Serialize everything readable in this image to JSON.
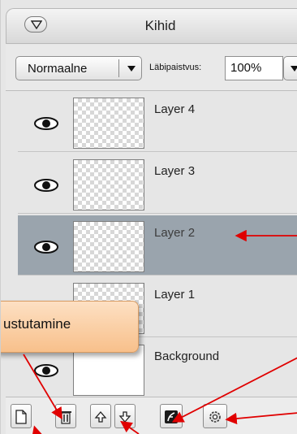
{
  "panel": {
    "title": "Kihid",
    "blend_mode": "Normaalne",
    "opacity_label": "Läbipaistvus:",
    "opacity_value": "100%"
  },
  "layers": [
    {
      "name": "Layer 4",
      "visible": true,
      "selected": false
    },
    {
      "name": "Layer 3",
      "visible": true,
      "selected": false
    },
    {
      "name": "Layer 2",
      "visible": true,
      "selected": true
    },
    {
      "name": "Layer 1",
      "visible": true,
      "selected": false
    },
    {
      "name": "Background",
      "visible": true,
      "selected": false
    }
  ],
  "tooltip": {
    "text": "ustutamine"
  },
  "toolbar_icons": [
    "new-layer-icon",
    "trash-icon",
    "move-up-icon",
    "move-down-icon",
    "layer-style-icon",
    "gear-icon"
  ],
  "colors": {
    "selected_row": "#9aa4ad",
    "annotation_arrow": "#e00000",
    "tooltip_fill": "#f8c08b"
  }
}
